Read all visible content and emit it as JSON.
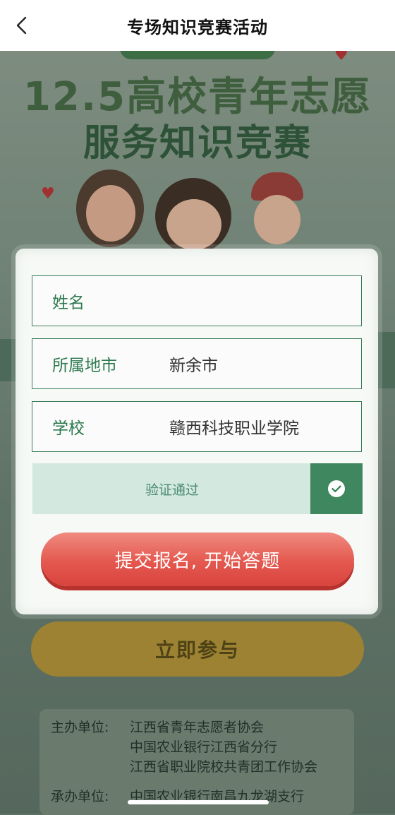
{
  "header": {
    "title": "专场知识竞赛活动"
  },
  "poster": {
    "title_line1": "12.5高校青年志愿",
    "title_line2": "服务知识竞赛",
    "join_button": "立即参与",
    "organizers": [
      {
        "label": "主办单位:",
        "values": [
          "江西省青年志愿者协会",
          "中国农业银行江西省分行",
          "江西省职业院校共青团工作协会"
        ]
      },
      {
        "label": "承办单位:",
        "values": [
          "中国农业银行南昌九龙湖支行"
        ]
      }
    ]
  },
  "form": {
    "name": {
      "label": "姓名",
      "value": ""
    },
    "city": {
      "label": "所属地市",
      "value": "新余市"
    },
    "school": {
      "label": "学校",
      "value": "赣西科技职业学院"
    },
    "verify": {
      "text": "验证通过"
    },
    "submit": "提交报名, 开始答题"
  },
  "colors": {
    "accent_green": "#3f875f",
    "submit_red": "#e4584f",
    "verify_bg": "#d3e8df"
  }
}
